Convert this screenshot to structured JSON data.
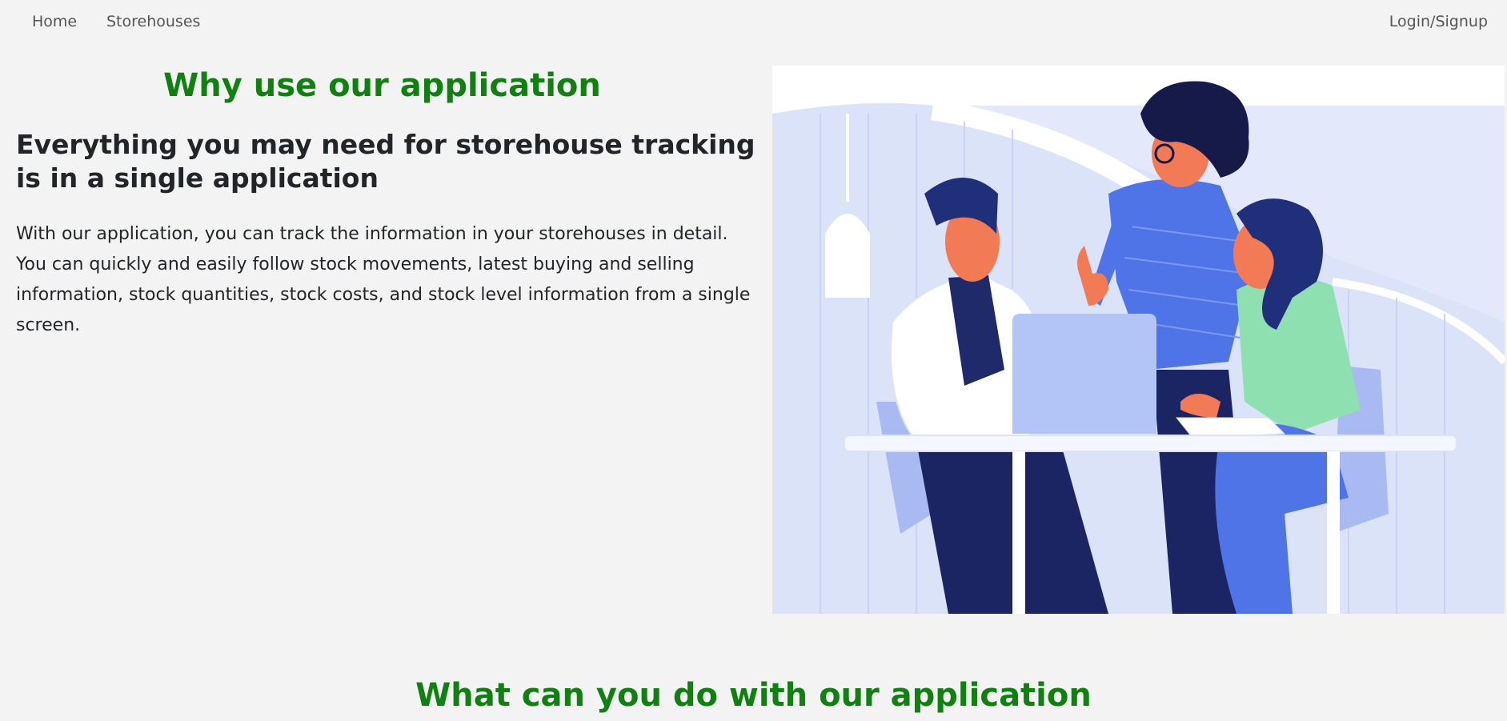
{
  "nav": {
    "home_label": "Home",
    "storehouses_label": "Storehouses",
    "login_label": "Login/Signup"
  },
  "hero": {
    "title": "Why use our application",
    "heading": "Everything you may need for storehouse tracking is in a single application",
    "body": "With our application, you can track the information in your storehouses in detail. You can quickly and easily follow stock movements, latest buying and selling information, stock quantities, stock costs, and stock level information from a single screen.",
    "illustration": "team-meeting-illustration"
  },
  "features": {
    "title": "What can you do with our application"
  },
  "colors": {
    "accent_green": "#108010",
    "page_bg": "#f3f3f3",
    "illustration_blue": "#4f74e8"
  }
}
